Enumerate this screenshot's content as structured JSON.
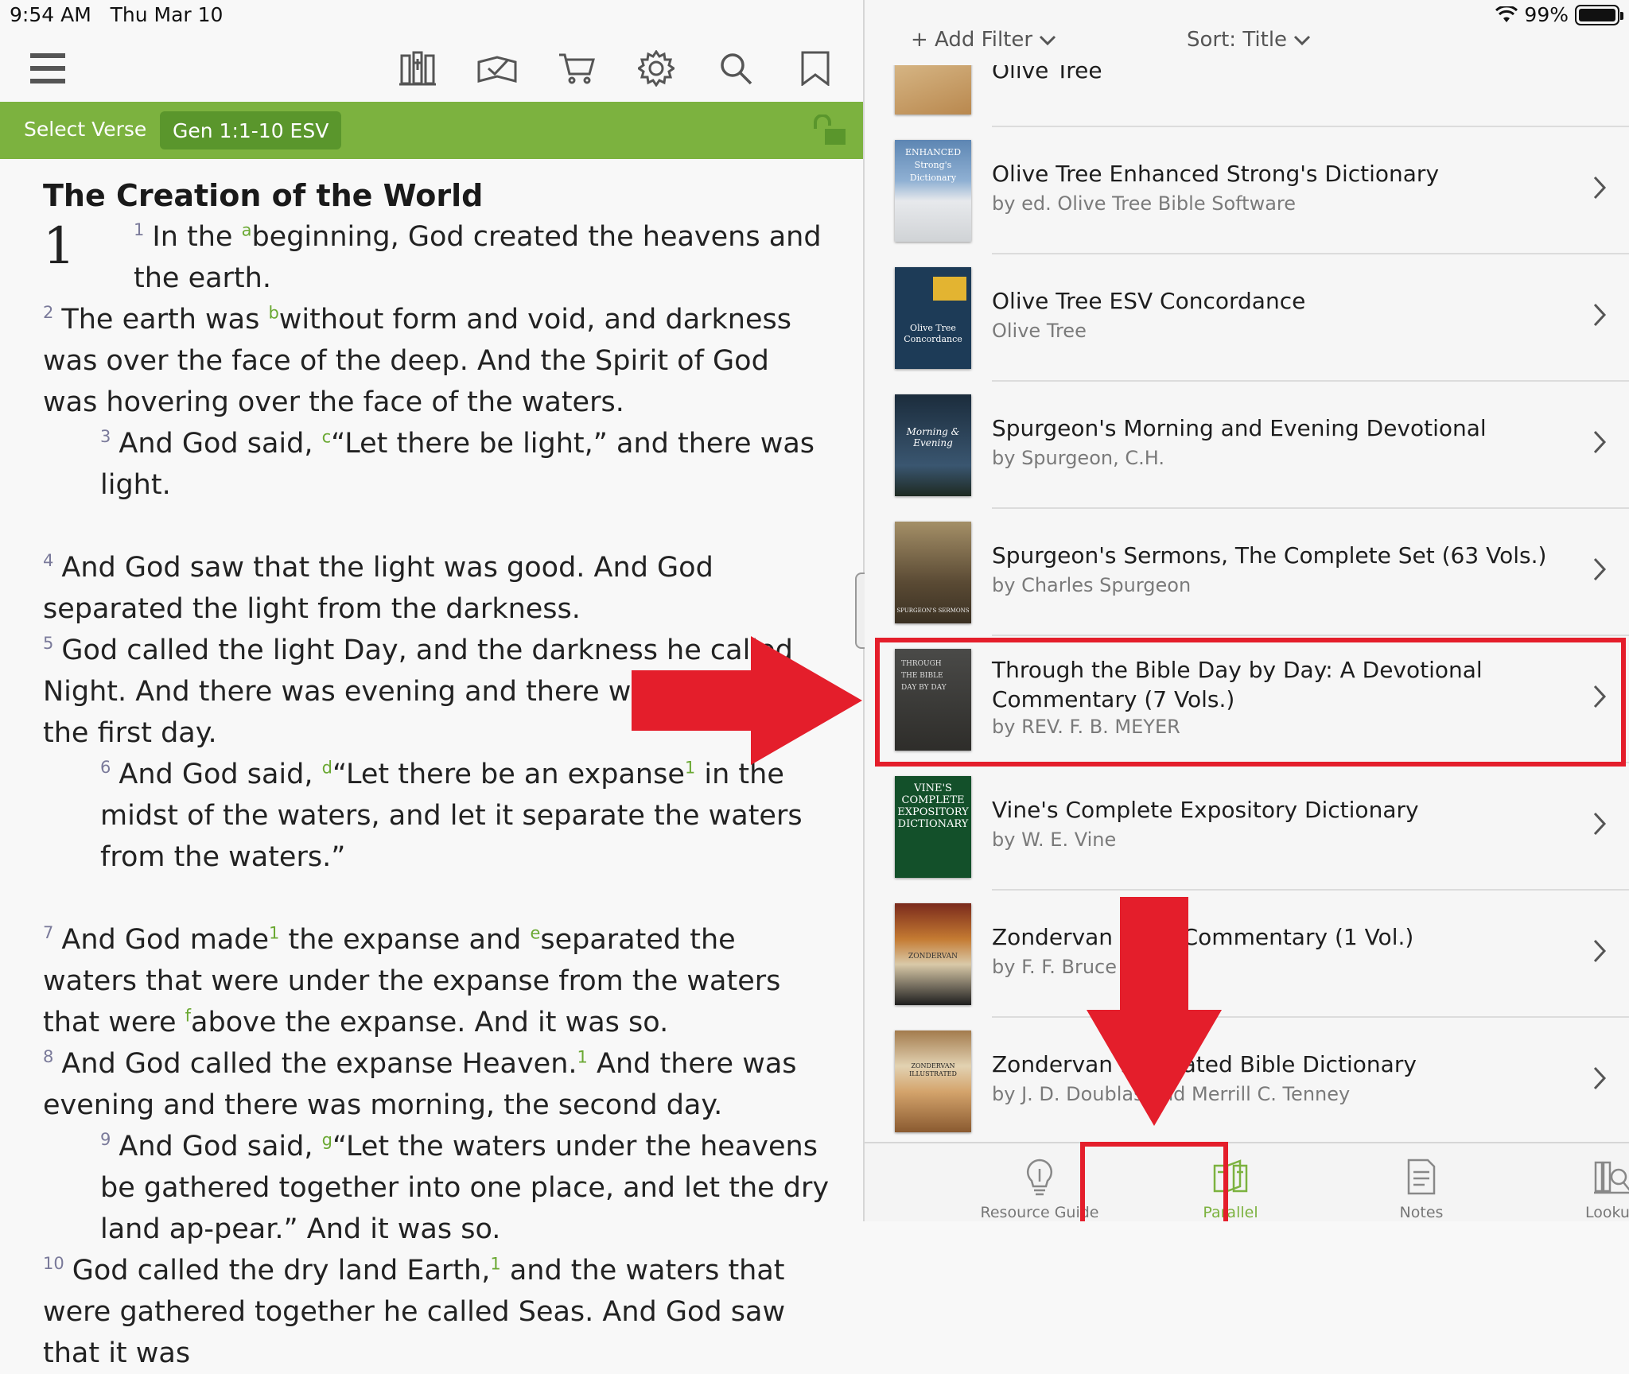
{
  "status": {
    "time": "9:54 AM",
    "date": "Thu Mar 10",
    "battery": "99%"
  },
  "toolbar": {
    "icons": [
      "menu-icon",
      "library-icon",
      "reading-plan-icon",
      "cart-icon",
      "settings-icon",
      "search-icon",
      "bookmark-icon"
    ]
  },
  "verse_bar": {
    "select_label": "Select Verse",
    "reference": "Gen 1:1-10 ESV"
  },
  "reader": {
    "section_title": "The Creation of the World",
    "chapter": "1",
    "verses": [
      {
        "n": "1",
        "pre": "In the ",
        "fn": "a",
        "text": "beginning, God created the heavens and the earth."
      },
      {
        "n": "2",
        "pre": "The earth was ",
        "fn": "b",
        "text": "without form and void, and darkness was over the face of the deep. And the Spirit of God was hovering over the face of the waters."
      },
      {
        "n": "3",
        "pre": "And God said, ",
        "fn": "c",
        "text": "“Let there be light,” and there was light."
      },
      {
        "n": "4",
        "text": "And God saw that the light was good. And God separated the light from the darkness."
      },
      {
        "n": "5",
        "text": "God called the light Day, and the darkness he called Night. And there was evening and there was morning, the first day."
      },
      {
        "n": "6",
        "pre": "And God said, ",
        "fn": "d",
        "text": "“Let there be an expanse",
        "fn2": "1",
        "text2": " in the midst of the waters, and let it separate the waters from the waters.”"
      },
      {
        "n": "7",
        "pre": "And God made",
        "fn": "1",
        "mid": " the expanse and ",
        "fn2": "e",
        "text": "separated the waters that were under the expanse from the waters that were ",
        "fn3": "f",
        "text2": "above the expanse. And it was so."
      },
      {
        "n": "8",
        "pre": "And God called the expanse Heaven.",
        "fn": "1",
        "text": " And there was evening and there was morning, the second day."
      },
      {
        "n": "9",
        "pre": "And God said, ",
        "fn": "g",
        "text": "“Let the waters under the heavens be gathered together into one place, and let the dry land ap-pear.” And it was so."
      },
      {
        "n": "10",
        "pre": "God called the dry land Earth,",
        "fn": "1",
        "text": " and the waters that were gathered together he called Seas. And God saw that it was"
      }
    ]
  },
  "filter": {
    "add_filter": "+ Add Filter",
    "sort": "Sort: Title"
  },
  "resources": [
    {
      "title": "Olive Tree",
      "author": ""
    },
    {
      "title": "Olive Tree Enhanced Strong's Dictionary",
      "author": "by ed. Olive Tree Bible Software",
      "cover_text": "ENHANCED Strong's Dictionary"
    },
    {
      "title": "Olive Tree ESV Concordance",
      "author": "Olive Tree",
      "cover_text": "Olive Tree Concordance"
    },
    {
      "title": "Spurgeon's Morning and Evening Devotional",
      "author": "by Spurgeon, C.H.",
      "cover_text": "Morning & Evening"
    },
    {
      "title": "Spurgeon's Sermons, The Complete Set (63 Vols.)",
      "author": "by Charles Spurgeon",
      "cover_text": "SPURGEON'S SERMONS"
    },
    {
      "title": "Through the Bible Day by Day: A Devotional Commentary (7 Vols.)",
      "author": "by REV. F. B. MEYER",
      "cover_text": "THROUGH THE BIBLE DAY BY DAY"
    },
    {
      "title": "Vine's Complete Expository Dictionary",
      "author": "by W. E. Vine",
      "cover_text": "VINE'S COMPLETE EXPOSITORY DICTIONARY"
    },
    {
      "title": "Zondervan Bible Commentary (1 Vol.)",
      "author": "by F. F. Bruce",
      "cover_text": "ZONDERVAN"
    },
    {
      "title": "Zondervan Illustrated Bible Dictionary",
      "author": "by J. D. Doublas and Merrill C. Tenney",
      "cover_text": "ZONDERVAN ILLUSTRATED"
    }
  ],
  "tabs": [
    {
      "label": "Resource Guide",
      "icon": "lightbulb-icon"
    },
    {
      "label": "Parallel",
      "icon": "parallel-books-icon",
      "active": true
    },
    {
      "label": "Notes",
      "icon": "notes-icon"
    },
    {
      "label": "Lookup",
      "icon": "lookup-icon"
    }
  ],
  "colors": {
    "accent": "#7cb23f",
    "accent_dark": "#5a962c",
    "annotation": "#e41e2b"
  }
}
